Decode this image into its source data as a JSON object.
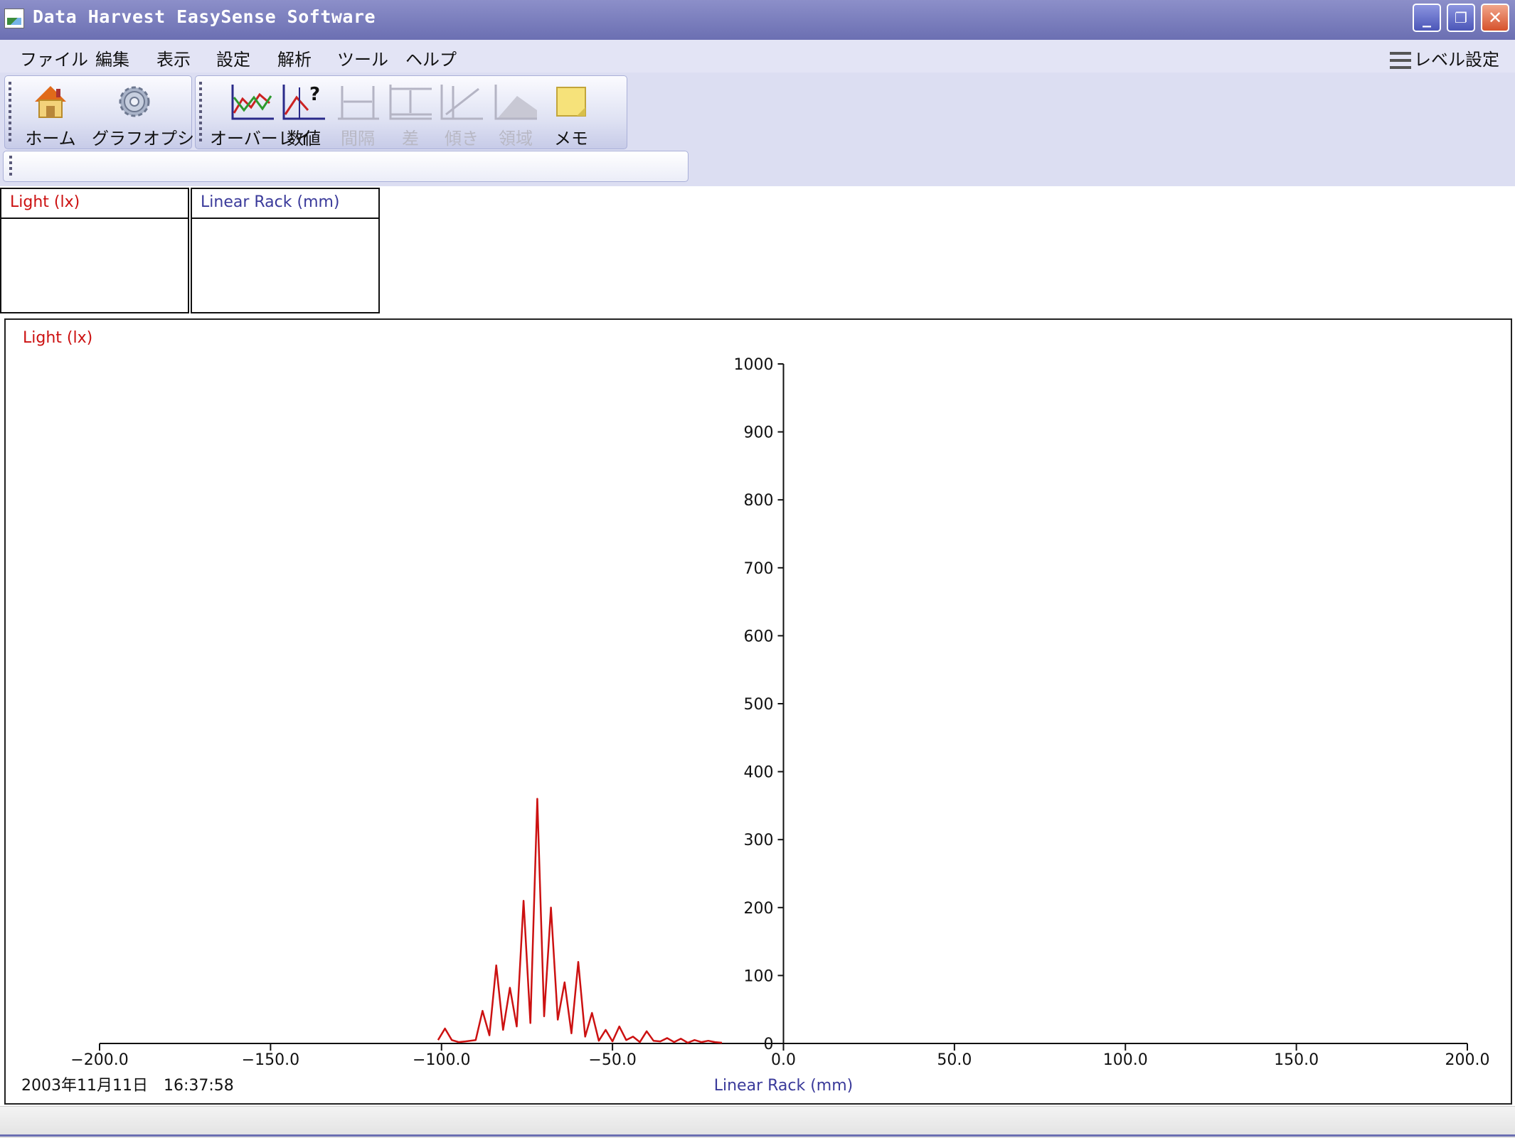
{
  "window": {
    "title": "Data Harvest EasySense Software",
    "controls": {
      "minimize": "_",
      "restore": "❐",
      "close": "✕"
    }
  },
  "menu": {
    "items": [
      "ファイル",
      "編集",
      "表示",
      "設定",
      "解析",
      "ツール",
      "ヘルプ"
    ],
    "level_setting": "レベル設定"
  },
  "toolbar": {
    "home": "ホーム",
    "graph_options": "グラフオプション",
    "overlay": "オーバーレイ",
    "values": "数値",
    "interval": "間隔",
    "difference": "差",
    "gradient": "傾き",
    "area": "領域",
    "memo": "メモ",
    "icons": {
      "home": "house-icon",
      "graph_options": "gear-icon",
      "overlay": "overlay-chart-icon",
      "values": "value-query-icon",
      "interval": "interval-icon",
      "difference": "difference-icon",
      "gradient": "gradient-icon",
      "area": "area-icon",
      "memo": "memo-icon"
    }
  },
  "meters": [
    {
      "label": "Light (lx)",
      "color": "#cc1111"
    },
    {
      "label": "Linear Rack (mm)",
      "color": "#3a3a9a"
    }
  ],
  "colors": {
    "light": "#cc1111",
    "rack": "#3a3a9a",
    "titlebar": "#7a7dbe"
  },
  "chart_data": {
    "type": "line",
    "title": "",
    "ylabel": "Light (lx)",
    "xlabel": "Linear Rack (mm)",
    "xlim": [
      -200,
      200
    ],
    "ylim": [
      0,
      1000
    ],
    "x_ticks": [
      "−200.0",
      "−150.0",
      "−100.0",
      "−50.0",
      "0.0",
      "50.0",
      "100.0",
      "150.0",
      "200.0"
    ],
    "y_ticks": [
      "0",
      "100",
      "200",
      "300",
      "400",
      "500",
      "600",
      "700",
      "800",
      "900",
      "1000"
    ],
    "grid": false,
    "timestamp": "2003年11月11日　16:37:58",
    "series": [
      {
        "color": "#cc1111",
        "x": [
          -101,
          -99,
          -97,
          -95,
          -93,
          -90,
          -88,
          -86,
          -84,
          -82,
          -80,
          -78,
          -76,
          -74,
          -72,
          -70,
          -68,
          -66,
          -64,
          -62,
          -60,
          -58,
          -56,
          -54,
          -52,
          -50,
          -48,
          -46,
          -44,
          -42,
          -40,
          -38,
          -36,
          -34,
          -32,
          -30,
          -28,
          -26,
          -24,
          -22,
          -20,
          -18
        ],
        "y": [
          5,
          22,
          5,
          2,
          3,
          5,
          48,
          12,
          115,
          20,
          82,
          25,
          210,
          30,
          360,
          40,
          200,
          35,
          90,
          15,
          120,
          10,
          45,
          4,
          20,
          3,
          25,
          5,
          10,
          2,
          18,
          4,
          3,
          8,
          2,
          7,
          1,
          5,
          2,
          4,
          2,
          1
        ]
      }
    ]
  }
}
